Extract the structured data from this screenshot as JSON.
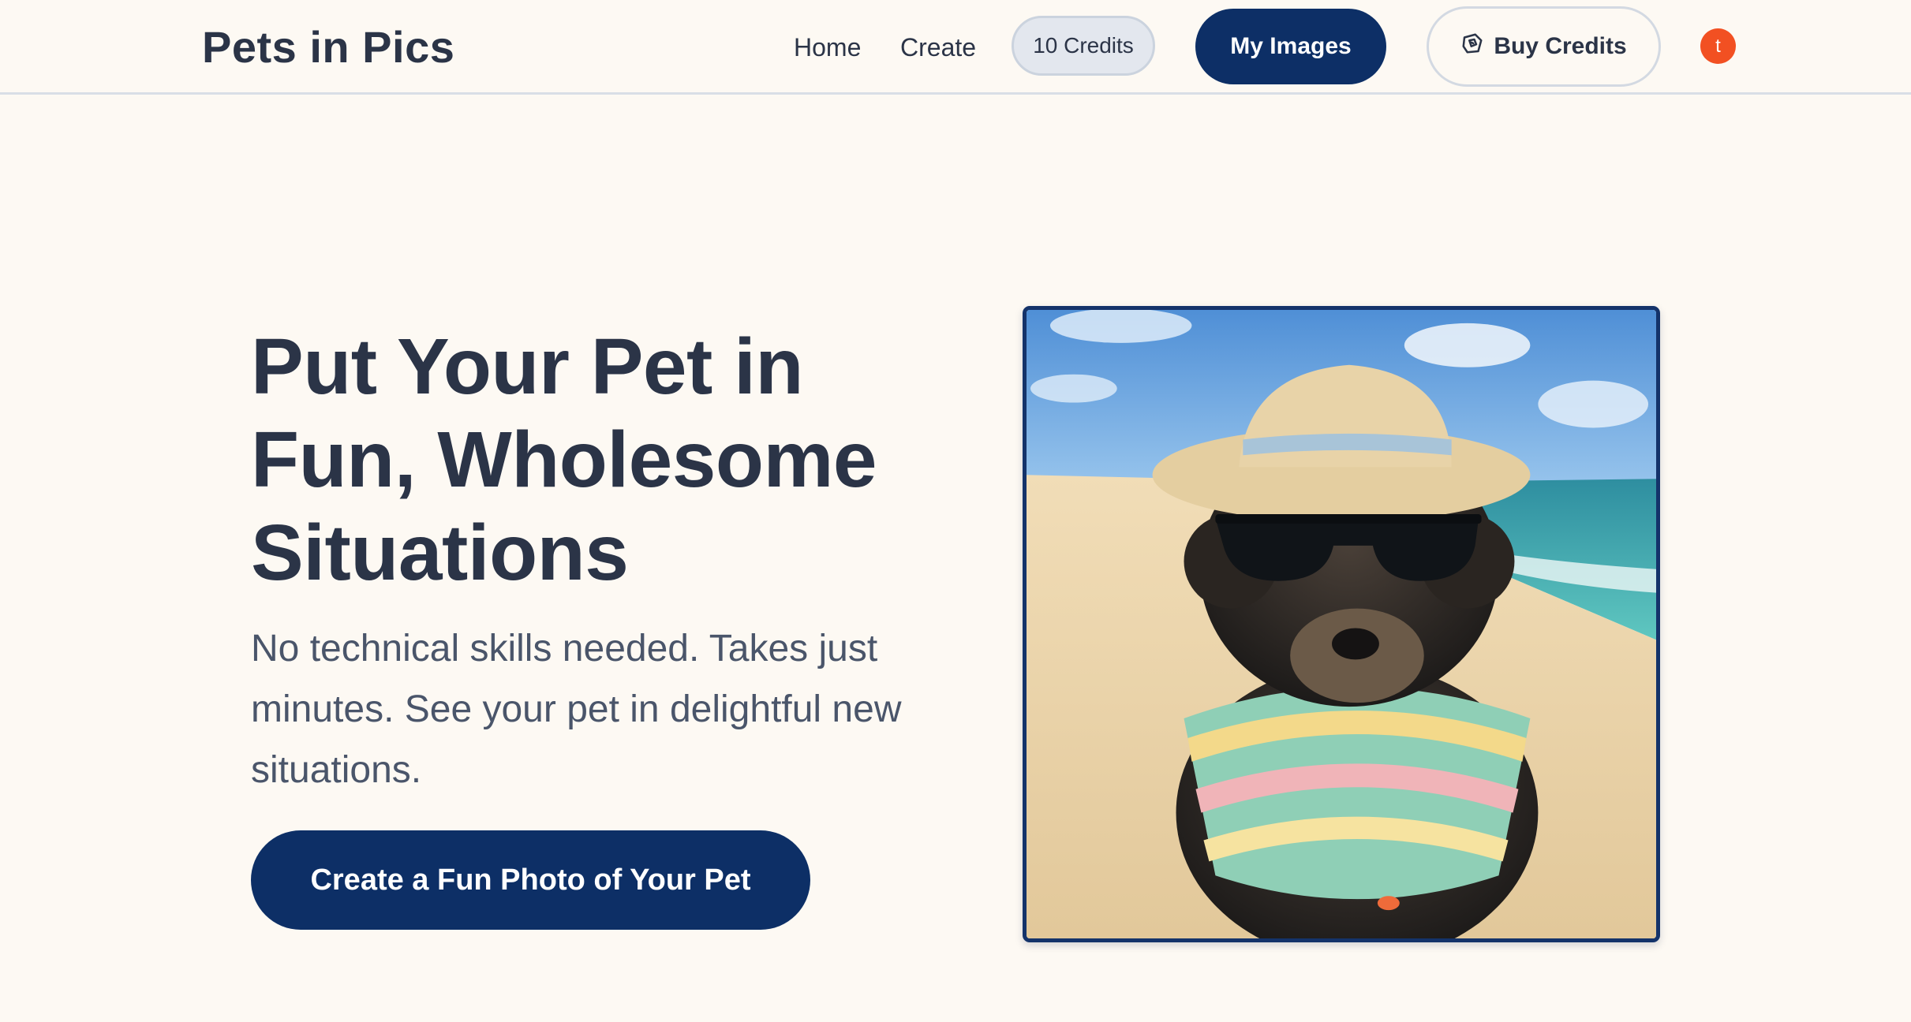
{
  "header": {
    "brand": "Pets in Pics",
    "nav": {
      "home": "Home",
      "create": "Create"
    },
    "credits": "10 Credits",
    "my_images": "My Images",
    "buy_credits": "Buy Credits",
    "avatar_initial": "t"
  },
  "hero": {
    "title": "Put Your Pet in Fun, Wholesome Situations",
    "subtitle": "No technical skills needed. Takes just minutes. See your pet in delightful new situations.",
    "cta": "Create a Fun Photo of Your Pet",
    "image_icon": "dog-on-beach-photo"
  },
  "colors": {
    "background": "#fdf9f3",
    "primary": "#0d2f66",
    "text": "#2b3447",
    "avatar": "#f25022"
  }
}
